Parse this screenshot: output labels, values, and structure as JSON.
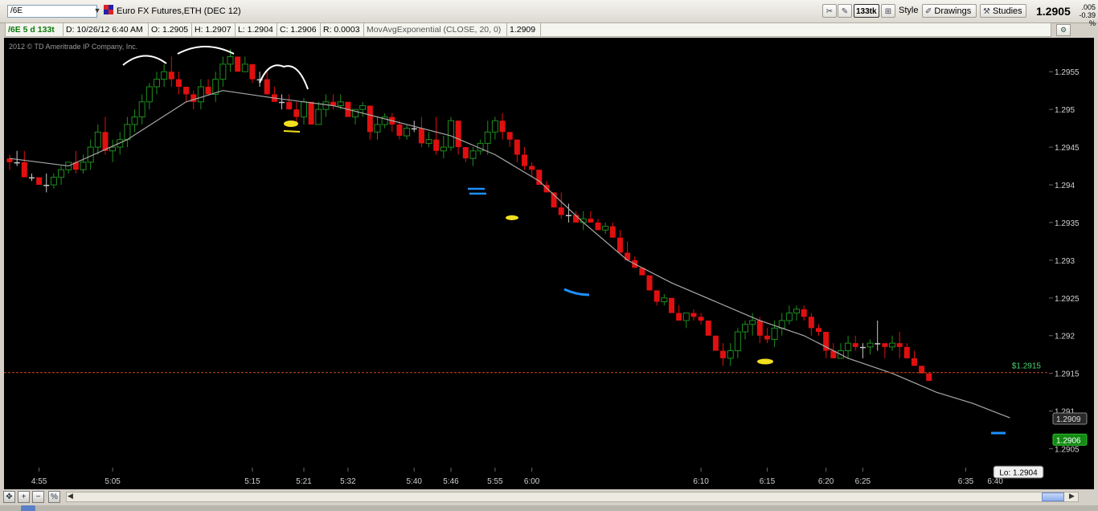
{
  "toolbar": {
    "symbol_value": "/6E",
    "title": "Euro FX Futures,ETH (DEC 12)",
    "tick_label": "133tk",
    "style_label": "Style",
    "drawings_label": "Drawings",
    "studies_label": "Studies",
    "last_price": "1.2905",
    "change": ".005",
    "change_pct": "-0.39 %"
  },
  "infobar": {
    "symbol_agg": "/6E 5 d 133t",
    "date": "D: 10/26/12 6:40 AM",
    "open": "O: 1.2905",
    "high": "H: 1.2907",
    "low": "L: 1.2904",
    "close": "C: 1.2906",
    "range": "R: 0.0003",
    "study": "MovAvgExponential (CLOSE, 20, 0)",
    "study_value": "1.2909"
  },
  "colors": {
    "background": "#000000",
    "up_candle": "#1e8e1e",
    "down_candle": "#e01010",
    "doji": "#c8c8c8",
    "ema": "#a8a8a8",
    "price_line": "#c84a1e",
    "axis_text": "#d0d0d0"
  },
  "chart_data": {
    "type": "candlestick",
    "copyright": "2012 © TD Ameritrade IP Company, Inc.",
    "ylim": [
      1.29025,
      1.29595
    ],
    "y_ticks": [
      "1.2955",
      "1.295",
      "1.2945",
      "1.294",
      "1.2935",
      "1.293",
      "1.2925",
      "1.292",
      "1.2915",
      "1.291",
      "1.2905"
    ],
    "x_ticks": [
      "4:55",
      "5:05",
      "5:15",
      "5:21",
      "5:32",
      "5:40",
      "5:46",
      "5:55",
      "6:00",
      "6:10",
      "6:15",
      "6:20",
      "6:25",
      "6:35",
      "6:40"
    ],
    "x_tick_slots": [
      4,
      14,
      33,
      40,
      46,
      55,
      60,
      66,
      71,
      94,
      103,
      111,
      116,
      130,
      134
    ],
    "price_line": {
      "value": 1.29151,
      "label": "$1.2915"
    },
    "ema_label": "1.2909",
    "ema_value": 1.2909,
    "last_label": "1.2906",
    "last_value": 1.29062,
    "low_label": "Lo: 1.2904",
    "low_value": 1.29042,
    "ema_points": [
      [
        0,
        1.29435
      ],
      [
        8,
        1.29425
      ],
      [
        16,
        1.2946
      ],
      [
        24,
        1.2951
      ],
      [
        29,
        1.29525
      ],
      [
        36,
        1.29515
      ],
      [
        44,
        1.29505
      ],
      [
        52,
        1.29485
      ],
      [
        60,
        1.29465
      ],
      [
        66,
        1.2944
      ],
      [
        72,
        1.29405
      ],
      [
        78,
        1.2935
      ],
      [
        84,
        1.293
      ],
      [
        90,
        1.2927
      ],
      [
        96,
        1.29245
      ],
      [
        102,
        1.2922
      ],
      [
        108,
        1.292
      ],
      [
        114,
        1.2917
      ],
      [
        120,
        1.2915
      ],
      [
        126,
        1.29125
      ],
      [
        131,
        1.2911
      ],
      [
        136,
        1.29091
      ]
    ],
    "candles_ohlc": [
      [
        1.29435,
        1.2944,
        1.2942,
        1.2943
      ],
      [
        1.2943,
        1.29445,
        1.29425,
        1.2943
      ],
      [
        1.2943,
        1.29445,
        1.2941,
        1.2941
      ],
      [
        1.2941,
        1.29415,
        1.29405,
        1.2941
      ],
      [
        1.2941,
        1.2941,
        1.294,
        1.294
      ],
      [
        1.294,
        1.29415,
        1.2939,
        1.294
      ],
      [
        1.294,
        1.29415,
        1.29395,
        1.2941
      ],
      [
        1.2941,
        1.29425,
        1.294,
        1.2942
      ],
      [
        1.2942,
        1.2943,
        1.29415,
        1.2943
      ],
      [
        1.2943,
        1.29445,
        1.29415,
        1.2942
      ],
      [
        1.2942,
        1.2944,
        1.29415,
        1.2943
      ],
      [
        1.2943,
        1.2946,
        1.2942,
        1.2945
      ],
      [
        1.2945,
        1.2948,
        1.2944,
        1.2947
      ],
      [
        1.2947,
        1.2949,
        1.2944,
        1.29445
      ],
      [
        1.29445,
        1.2946,
        1.2943,
        1.2945
      ],
      [
        1.2945,
        1.2947,
        1.2944,
        1.2946
      ],
      [
        1.2946,
        1.2949,
        1.2945,
        1.2948
      ],
      [
        1.2948,
        1.295,
        1.2947,
        1.2949
      ],
      [
        1.2949,
        1.2952,
        1.2948,
        1.2951
      ],
      [
        1.2951,
        1.29535,
        1.295,
        1.2953
      ],
      [
        1.2953,
        1.2955,
        1.2952,
        1.2954
      ],
      [
        1.2954,
        1.2956,
        1.2953,
        1.2955
      ],
      [
        1.2955,
        1.2957,
        1.2953,
        1.2954
      ],
      [
        1.2954,
        1.2955,
        1.2952,
        1.2953
      ],
      [
        1.2953,
        1.2953,
        1.2951,
        1.2952
      ],
      [
        1.2952,
        1.29525,
        1.295,
        1.2951
      ],
      [
        1.2951,
        1.2954,
        1.295,
        1.2953
      ],
      [
        1.2953,
        1.2954,
        1.2952,
        1.2952
      ],
      [
        1.2952,
        1.2955,
        1.2951,
        1.2954
      ],
      [
        1.2954,
        1.2957,
        1.2953,
        1.2956
      ],
      [
        1.2956,
        1.2958,
        1.2955,
        1.2957
      ],
      [
        1.2957,
        1.2957,
        1.2955,
        1.2955
      ],
      [
        1.2955,
        1.2957,
        1.2955,
        1.2956
      ],
      [
        1.2956,
        1.2956,
        1.29535,
        1.2954
      ],
      [
        1.2954,
        1.2955,
        1.2953,
        1.2954
      ],
      [
        1.2954,
        1.2955,
        1.2952,
        1.2952
      ],
      [
        1.2952,
        1.2953,
        1.2951,
        1.2951
      ],
      [
        1.2951,
        1.2952,
        1.295,
        1.2951
      ],
      [
        1.2951,
        1.2952,
        1.295,
        1.295
      ],
      [
        1.295,
        1.2951,
        1.2948,
        1.2949
      ],
      [
        1.2949,
        1.29515,
        1.2948,
        1.2951
      ],
      [
        1.2951,
        1.2951,
        1.2948,
        1.2948
      ],
      [
        1.2948,
        1.2951,
        1.2948,
        1.295
      ],
      [
        1.295,
        1.2952,
        1.2949,
        1.2951
      ],
      [
        1.2951,
        1.2952,
        1.295,
        1.29505
      ],
      [
        1.29505,
        1.2952,
        1.295,
        1.2951
      ],
      [
        1.2951,
        1.2951,
        1.2949,
        1.2949
      ],
      [
        1.2949,
        1.295,
        1.2948,
        1.295
      ],
      [
        1.295,
        1.2951,
        1.2949,
        1.29505
      ],
      [
        1.29505,
        1.29505,
        1.2946,
        1.2947
      ],
      [
        1.2947,
        1.2949,
        1.2946,
        1.2948
      ],
      [
        1.2948,
        1.29495,
        1.29475,
        1.2949
      ],
      [
        1.2949,
        1.29495,
        1.2947,
        1.2948
      ],
      [
        1.2948,
        1.29485,
        1.2946,
        1.29465
      ],
      [
        1.29465,
        1.2948,
        1.2946,
        1.29475
      ],
      [
        1.29475,
        1.29485,
        1.2947,
        1.29475
      ],
      [
        1.29475,
        1.2949,
        1.2945,
        1.29455
      ],
      [
        1.29455,
        1.2947,
        1.2945,
        1.2946
      ],
      [
        1.2946,
        1.2949,
        1.2944,
        1.29445
      ],
      [
        1.29445,
        1.29465,
        1.29435,
        1.2945
      ],
      [
        1.2945,
        1.2949,
        1.29445,
        1.29485
      ],
      [
        1.29485,
        1.29485,
        1.2944,
        1.2945
      ],
      [
        1.2945,
        1.2945,
        1.2943,
        1.29435
      ],
      [
        1.29435,
        1.2945,
        1.29425,
        1.29445
      ],
      [
        1.29445,
        1.2946,
        1.2944,
        1.29455
      ],
      [
        1.29455,
        1.29485,
        1.2944,
        1.2947
      ],
      [
        1.2947,
        1.2949,
        1.2946,
        1.29485
      ],
      [
        1.29485,
        1.29495,
        1.2946,
        1.2947
      ],
      [
        1.2947,
        1.2947,
        1.2945,
        1.2946
      ],
      [
        1.2946,
        1.2946,
        1.2943,
        1.2944
      ],
      [
        1.2944,
        1.2945,
        1.2942,
        1.29425
      ],
      [
        1.29425,
        1.2943,
        1.2941,
        1.2942
      ],
      [
        1.2942,
        1.2942,
        1.294,
        1.294
      ],
      [
        1.294,
        1.29405,
        1.2939,
        1.2939
      ],
      [
        1.2939,
        1.2939,
        1.2937,
        1.2937
      ],
      [
        1.2937,
        1.2939,
        1.29355,
        1.2936
      ],
      [
        1.2936,
        1.29375,
        1.2935,
        1.2936
      ],
      [
        1.2936,
        1.29365,
        1.2935,
        1.2935
      ],
      [
        1.2935,
        1.29365,
        1.2934,
        1.29355
      ],
      [
        1.29355,
        1.29365,
        1.2935,
        1.2935
      ],
      [
        1.2935,
        1.29355,
        1.2934,
        1.2934
      ],
      [
        1.2934,
        1.2935,
        1.29335,
        1.29345
      ],
      [
        1.29345,
        1.2935,
        1.2933,
        1.2933
      ],
      [
        1.2933,
        1.2934,
        1.2931,
        1.2931
      ],
      [
        1.2931,
        1.29325,
        1.293,
        1.293
      ],
      [
        1.293,
        1.29305,
        1.2929,
        1.2929
      ],
      [
        1.2929,
        1.2929,
        1.2928,
        1.2928
      ],
      [
        1.2928,
        1.2928,
        1.2926,
        1.2926
      ],
      [
        1.2926,
        1.2926,
        1.2924,
        1.29245
      ],
      [
        1.29245,
        1.29255,
        1.2924,
        1.2925
      ],
      [
        1.2925,
        1.2925,
        1.2923,
        1.2923
      ],
      [
        1.2923,
        1.2924,
        1.2922,
        1.2922
      ],
      [
        1.2922,
        1.2923,
        1.2921,
        1.2923
      ],
      [
        1.2923,
        1.29235,
        1.2922,
        1.29225
      ],
      [
        1.29225,
        1.2923,
        1.29215,
        1.2922
      ],
      [
        1.2922,
        1.2922,
        1.292,
        1.292
      ],
      [
        1.292,
        1.292,
        1.2918,
        1.2918
      ],
      [
        1.2918,
        1.2919,
        1.2916,
        1.2917
      ],
      [
        1.2917,
        1.2919,
        1.2916,
        1.2918
      ],
      [
        1.2918,
        1.2921,
        1.2917,
        1.29205
      ],
      [
        1.29205,
        1.2922,
        1.29195,
        1.29215
      ],
      [
        1.29215,
        1.2923,
        1.292,
        1.2922
      ],
      [
        1.2922,
        1.29225,
        1.2919,
        1.292
      ],
      [
        1.292,
        1.2921,
        1.2919,
        1.29195
      ],
      [
        1.29195,
        1.2922,
        1.29185,
        1.2921
      ],
      [
        1.2921,
        1.2923,
        1.292,
        1.2922
      ],
      [
        1.2922,
        1.2924,
        1.29215,
        1.2923
      ],
      [
        1.2923,
        1.2924,
        1.2922,
        1.29235
      ],
      [
        1.29235,
        1.2924,
        1.2922,
        1.29225
      ],
      [
        1.29225,
        1.2923,
        1.292,
        1.2921
      ],
      [
        1.2921,
        1.29215,
        1.292,
        1.29205
      ],
      [
        1.29205,
        1.29205,
        1.2917,
        1.2918
      ],
      [
        1.2918,
        1.2919,
        1.2917,
        1.2917
      ],
      [
        1.2917,
        1.2919,
        1.2917,
        1.2918
      ],
      [
        1.2918,
        1.292,
        1.2917,
        1.2919
      ],
      [
        1.2919,
        1.292,
        1.2918,
        1.29185
      ],
      [
        1.29185,
        1.2919,
        1.2917,
        1.29185
      ],
      [
        1.29185,
        1.29195,
        1.29175,
        1.2919
      ],
      [
        1.2919,
        1.2922,
        1.2918,
        1.2919
      ],
      [
        1.2919,
        1.2919,
        1.2917,
        1.29185
      ],
      [
        1.29185,
        1.292,
        1.2918,
        1.2919
      ],
      [
        1.2919,
        1.29205,
        1.2917,
        1.29185
      ],
      [
        1.29185,
        1.2919,
        1.2917,
        1.2917
      ],
      [
        1.2917,
        1.2918,
        1.2916,
        1.2916
      ],
      [
        1.2916,
        1.2916,
        1.2915,
        1.2915
      ],
      [
        1.2915,
        1.2915,
        1.2914,
        1.2914
      ]
    ]
  }
}
